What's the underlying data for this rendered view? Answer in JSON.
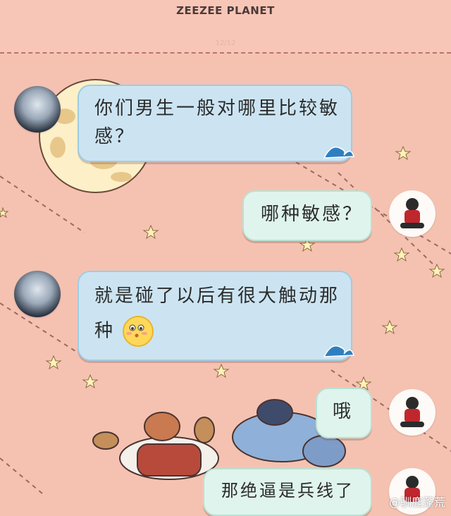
{
  "header": {
    "title": "ZEEZEE PLANET",
    "page_indicator": "12/12"
  },
  "messages": [
    {
      "side": "left",
      "text_line1": "你们男生一般对哪里比较敏",
      "text_line2": "感？"
    },
    {
      "side": "right",
      "text": "哪种敏感？"
    },
    {
      "side": "left",
      "text_line1": "就是碰了以后有很大触动那",
      "text_line2": "种"
    },
    {
      "side": "right",
      "text": "哦"
    },
    {
      "side": "right",
      "text": "那绝逼是兵线了"
    }
  ],
  "watermark": {
    "text": "@驯鹿蓬荒"
  },
  "colors": {
    "background": "#f5c2b1",
    "left_bubble": "#cce4f2",
    "right_bubble": "#dff4ec"
  },
  "icons": [
    "girl-avatar",
    "boy-avatar",
    "wave-icon",
    "emoji-icon",
    "star-icon",
    "moon"
  ]
}
